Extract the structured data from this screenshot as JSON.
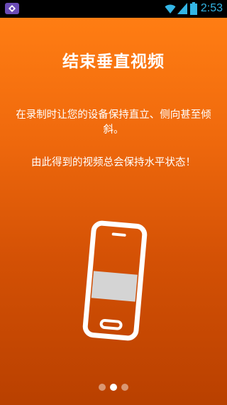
{
  "status_bar": {
    "time": "2:53",
    "time_color": "#33b5e5"
  },
  "onboarding": {
    "title": "结束垂直视频",
    "paragraph_1": "在录制时让您的设备保持直立、侧向甚至倾斜。",
    "paragraph_2": "由此得到的视频总会保持水平状态！",
    "background_top": "#ff7d13",
    "background_bottom": "#b94000",
    "pages_total": 3,
    "current_page": 2
  }
}
